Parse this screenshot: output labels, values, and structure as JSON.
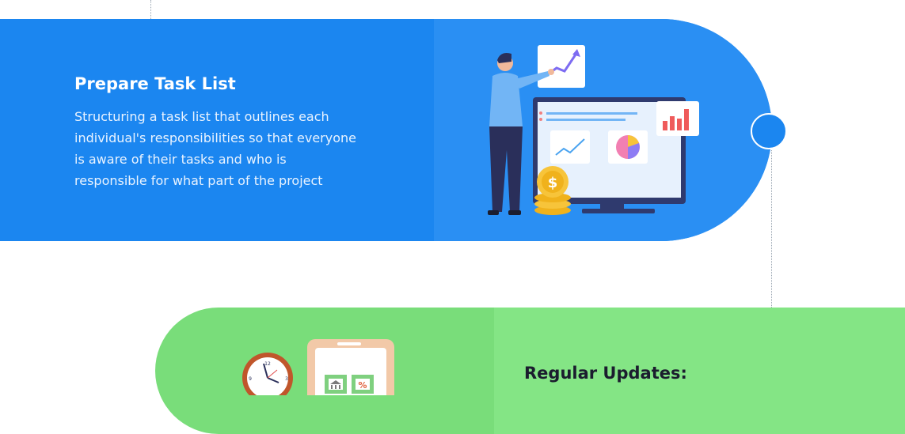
{
  "steps": [
    {
      "title": "Prepare Task List",
      "description_lines": [
        "Structuring a task list that outlines each",
        "individual's responsibilities so that everyone",
        "is aware of their tasks and who is",
        "responsible for what part of the project"
      ],
      "color": "#1b86f0",
      "illustration": "person-presenting-analytics-dashboard"
    },
    {
      "title": "Regular Updates:",
      "color": "#79dd7a",
      "illustration": "clock-and-mobile-banking"
    }
  ],
  "icons": [
    "trend-arrow-icon",
    "bar-chart-icon",
    "line-chart-icon",
    "pie-chart-icon",
    "dollar-coin-icon",
    "clock-icon",
    "bank-icon",
    "percent-icon"
  ]
}
